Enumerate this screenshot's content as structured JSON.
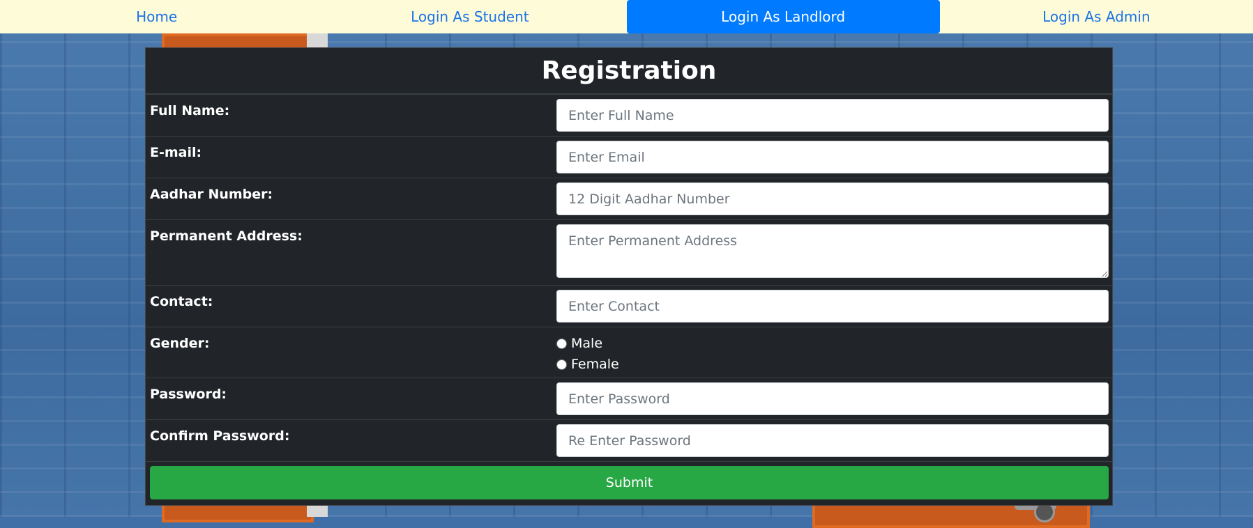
{
  "nav": {
    "items": [
      {
        "label": "Home",
        "active": false
      },
      {
        "label": "Login As Student",
        "active": false
      },
      {
        "label": "Login As Landlord",
        "active": true
      },
      {
        "label": "Login As Admin",
        "active": false
      }
    ]
  },
  "form": {
    "title": "Registration",
    "full_name": {
      "label": "Full Name:",
      "placeholder": "Enter Full Name"
    },
    "email": {
      "label": "E-mail:",
      "placeholder": "Enter Email"
    },
    "aadhar": {
      "label": "Aadhar Number:",
      "placeholder": "12 Digit Aadhar Number"
    },
    "address": {
      "label": "Permanent Address:",
      "placeholder": "Enter Permanent Address"
    },
    "contact": {
      "label": "Contact:",
      "placeholder": "Enter Contact"
    },
    "gender": {
      "label": "Gender:",
      "options": [
        "Male",
        "Female"
      ],
      "selected": null
    },
    "password": {
      "label": "Password:",
      "placeholder": "Enter Password"
    },
    "confirm_password": {
      "label": "Confirm Password:",
      "placeholder": "Re Enter Password"
    },
    "submit_label": "Submit"
  },
  "colors": {
    "nav_bg": "#fefbd8",
    "nav_active": "#007bff",
    "panel_bg": "#212529",
    "submit": "#28a745"
  }
}
